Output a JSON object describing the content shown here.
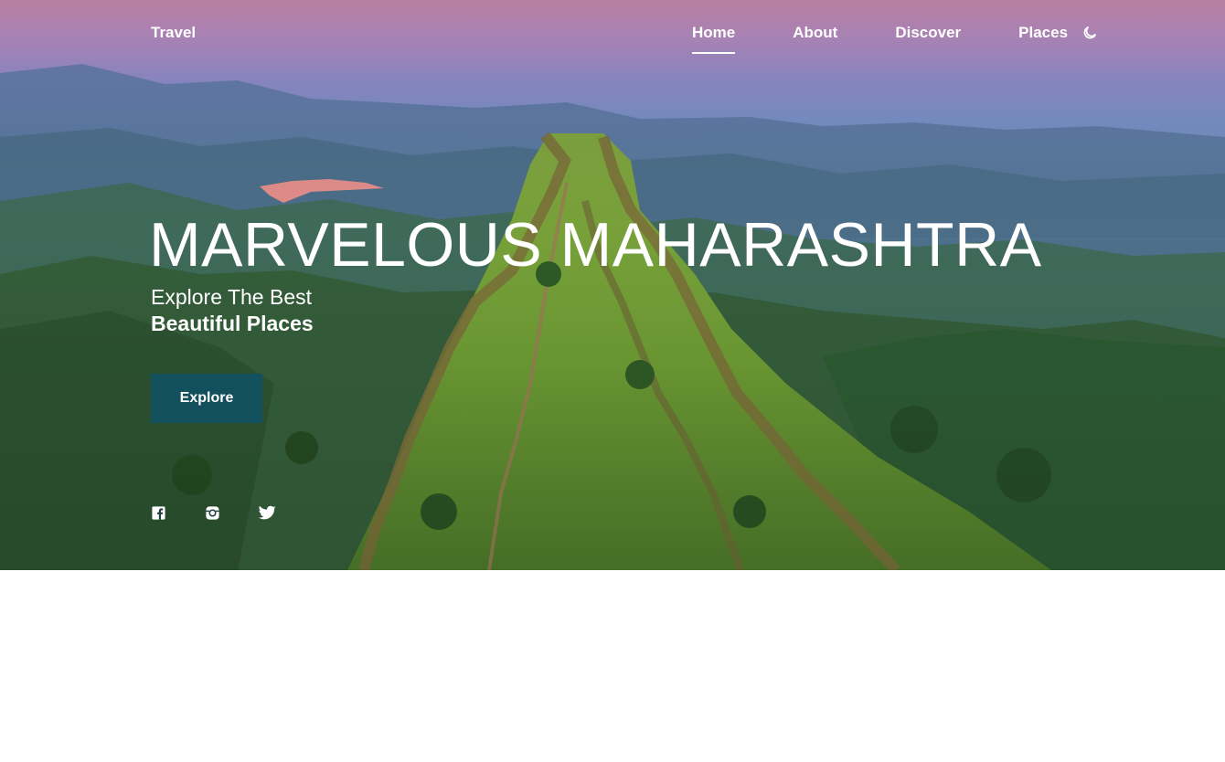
{
  "brand": "Travel",
  "nav": {
    "home": "Home",
    "about": "About",
    "discover": "Discover",
    "places": "Places",
    "theme_icon": "moon-icon"
  },
  "hero": {
    "title": "MARVELOUS MAHARASHTRA",
    "subtitle_part1": "Explore The Best ",
    "subtitle_bold": "Beautiful Places",
    "button": "Explore"
  },
  "social": [
    "facebook-icon",
    "instagram-icon",
    "twitter-icon"
  ],
  "colors": {
    "button_bg": "#12505e",
    "text": "#ffffff"
  }
}
